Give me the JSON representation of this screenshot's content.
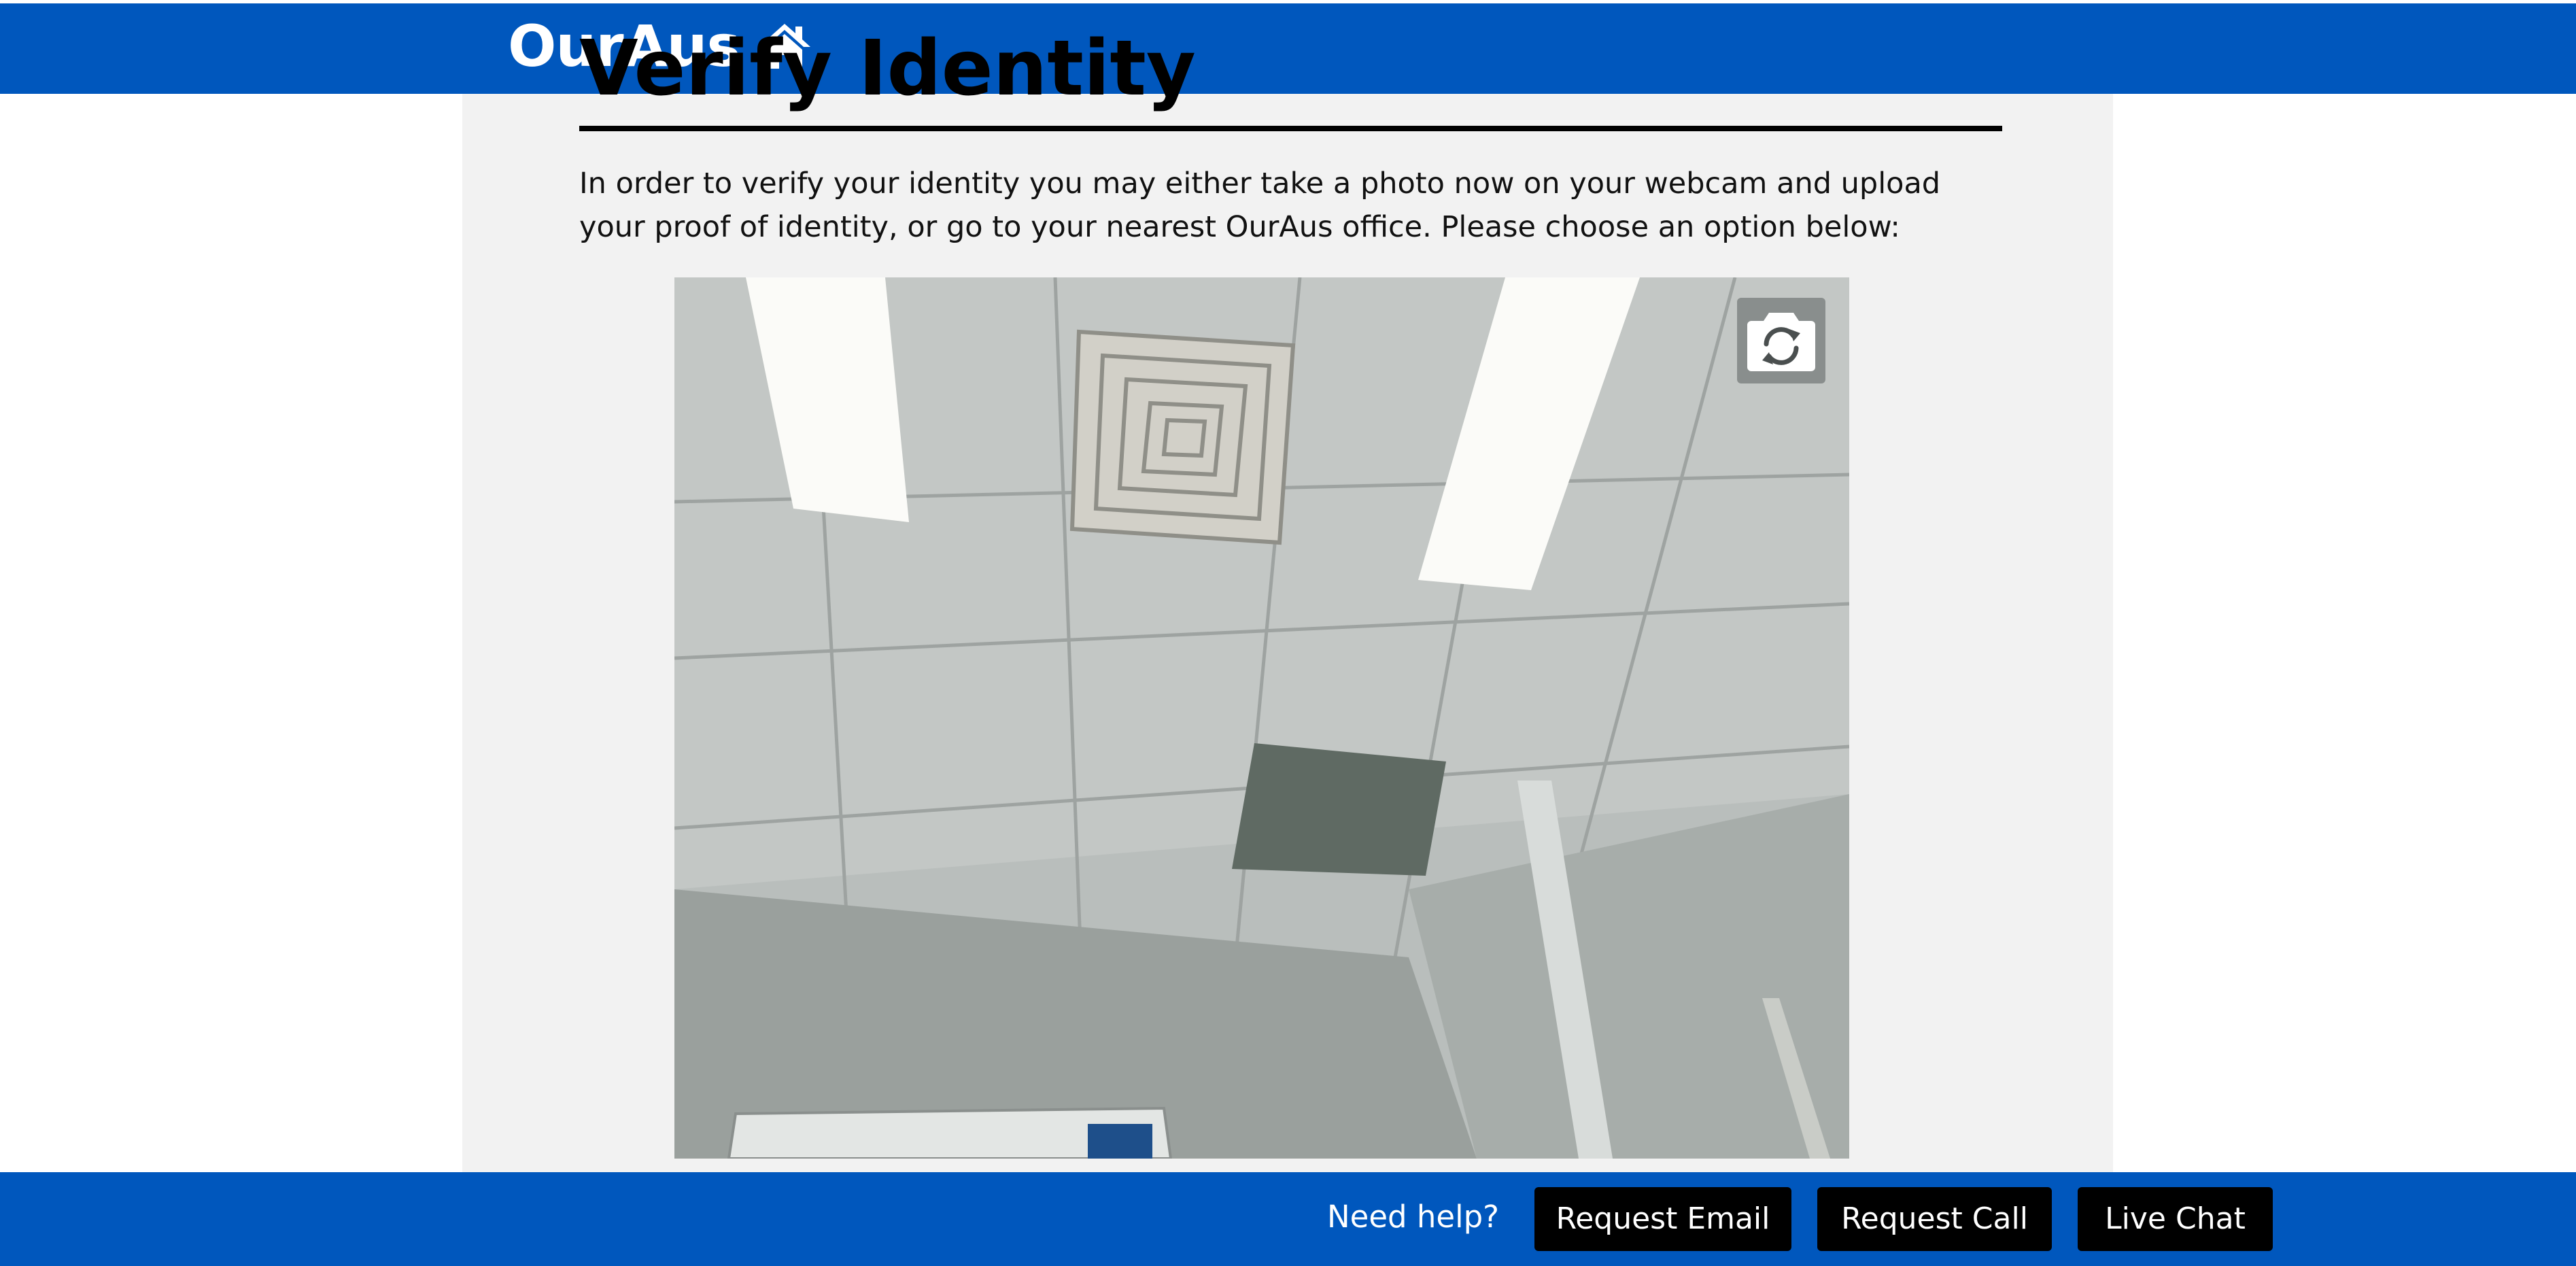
{
  "header": {
    "logo_text": "OurAus",
    "logo_icon": "home-icon",
    "background_color": "#0057bd"
  },
  "main": {
    "page_title": "Verify Identity",
    "intro_text": "In order to verify your identity you may either take a photo now on your webcam and upload your proof of identity, or go to your nearest OurAus office. Please choose an option below:",
    "webcam": {
      "switch_camera_icon": "camera-switch-icon"
    }
  },
  "footer": {
    "need_help_label": "Need help?",
    "request_email_label": "Request Email",
    "request_call_label": "Request Call",
    "live_chat_label": "Live Chat",
    "background_color": "#0057bd",
    "button_color": "#000000"
  }
}
